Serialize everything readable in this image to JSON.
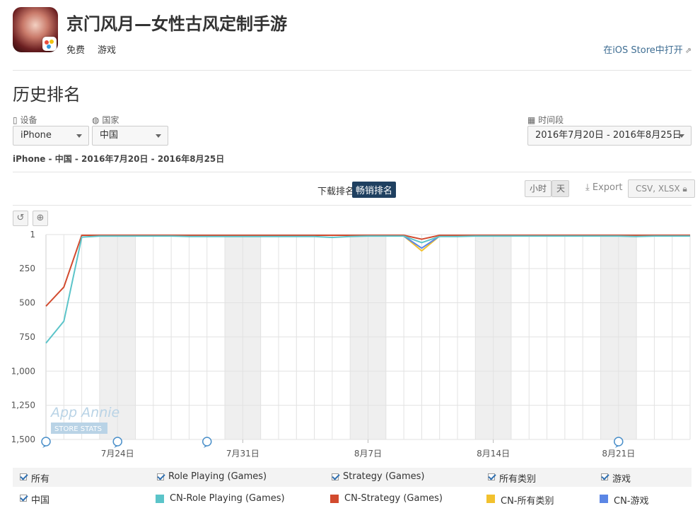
{
  "app": {
    "title": "京门风月—女性古风定制手游",
    "price": "免费",
    "category": "游戏",
    "open_store_label": "在iOS Store中打开"
  },
  "section_title": "历史排名",
  "filters": {
    "device_label": "设备",
    "device_value": "iPhone",
    "country_label": "国家",
    "country_value": "中国",
    "period_label": "时间段",
    "period_value": "2016年7月20日 - 2016年8月25日"
  },
  "summary": "iPhone - 中国 - 2016年7月20日 - 2016年8月25日",
  "toolbar": {
    "tab_download": "下载排名",
    "tab_grossing": "畅销排名",
    "hour": "小时",
    "day": "天",
    "export": "Export",
    "csv": "CSV, XLSX"
  },
  "watermark": {
    "line1": "App Annie",
    "line2": "STORE STATS"
  },
  "colors": {
    "role_playing": "#5bc4c9",
    "strategy": "#d24a2e",
    "all_categories": "#f2c12e",
    "games": "#5b86e5",
    "weekend_band": "#efefef",
    "active_tab": "#1f4060"
  },
  "chart_data": {
    "type": "line",
    "title": "",
    "xlabel": "",
    "ylabel": "",
    "y_inverted": true,
    "ylim": [
      1,
      1500
    ],
    "y_ticks": [
      "1",
      "250",
      "500",
      "750",
      "1,000",
      "1,250",
      "1,500"
    ],
    "x_tick_labels": [
      "7月24日",
      "7月31日",
      "8月7日",
      "8月14日",
      "8月21日"
    ],
    "x_dates": [
      "2016-07-20",
      "2016-07-21",
      "2016-07-22",
      "2016-07-23",
      "2016-07-24",
      "2016-07-25",
      "2016-07-26",
      "2016-07-27",
      "2016-07-28",
      "2016-07-29",
      "2016-07-30",
      "2016-07-31",
      "2016-08-01",
      "2016-08-02",
      "2016-08-03",
      "2016-08-04",
      "2016-08-05",
      "2016-08-06",
      "2016-08-07",
      "2016-08-08",
      "2016-08-09",
      "2016-08-10",
      "2016-08-11",
      "2016-08-12",
      "2016-08-13",
      "2016-08-14",
      "2016-08-15",
      "2016-08-16",
      "2016-08-17",
      "2016-08-18",
      "2016-08-19",
      "2016-08-20",
      "2016-08-21",
      "2016-08-22",
      "2016-08-23",
      "2016-08-24",
      "2016-08-25"
    ],
    "weekend_bands": [
      [
        "2016-07-23",
        "2016-07-25"
      ],
      [
        "2016-07-30",
        "2016-08-01"
      ],
      [
        "2016-08-06",
        "2016-08-08"
      ],
      [
        "2016-08-13",
        "2016-08-15"
      ],
      [
        "2016-08-20",
        "2016-08-22"
      ]
    ],
    "grid": true,
    "series": [
      {
        "name": "CN-Role Playing (Games)",
        "color": "#5bc4c9",
        "values": [
          795,
          635,
          20,
          12,
          12,
          12,
          12,
          12,
          15,
          15,
          15,
          15,
          15,
          15,
          15,
          15,
          22,
          15,
          12,
          12,
          12,
          60,
          15,
          15,
          12,
          12,
          12,
          12,
          12,
          12,
          12,
          12,
          12,
          15,
          12,
          12,
          12
        ]
      },
      {
        "name": "CN-Strategy (Games)",
        "color": "#d24a2e",
        "values": [
          525,
          385,
          6,
          6,
          6,
          6,
          6,
          6,
          6,
          6,
          6,
          6,
          6,
          6,
          6,
          6,
          6,
          6,
          6,
          6,
          6,
          35,
          6,
          6,
          6,
          6,
          6,
          6,
          6,
          6,
          6,
          6,
          6,
          6,
          6,
          6,
          6
        ]
      },
      {
        "name": "CN-所有类别",
        "color": "#f2c12e",
        "values": [
          null,
          null,
          null,
          null,
          null,
          null,
          null,
          null,
          null,
          null,
          null,
          null,
          null,
          null,
          null,
          null,
          null,
          null,
          null,
          null,
          12,
          120,
          12,
          null,
          null,
          null,
          null,
          null,
          null,
          null,
          null,
          null,
          null,
          null,
          null,
          null,
          null
        ]
      },
      {
        "name": "CN-游戏",
        "color": "#5b86e5",
        "values": [
          null,
          null,
          null,
          null,
          null,
          null,
          null,
          null,
          null,
          null,
          null,
          null,
          null,
          null,
          null,
          null,
          null,
          null,
          null,
          null,
          12,
          100,
          12,
          null,
          null,
          null,
          null,
          null,
          null,
          null,
          null,
          null,
          null,
          null,
          null,
          null,
          null
        ]
      }
    ],
    "event_markers": [
      "2016-07-20",
      "2016-07-24",
      "2016-07-29",
      "2016-08-21"
    ]
  },
  "legend": {
    "row1": [
      "所有",
      "Role Playing (Games)",
      "Strategy (Games)",
      "所有类别",
      "游戏"
    ],
    "row2_country": "中国",
    "row2_series": [
      "CN-Role Playing (Games)",
      "CN-Strategy (Games)",
      "CN-所有类别",
      "CN-游戏"
    ]
  }
}
